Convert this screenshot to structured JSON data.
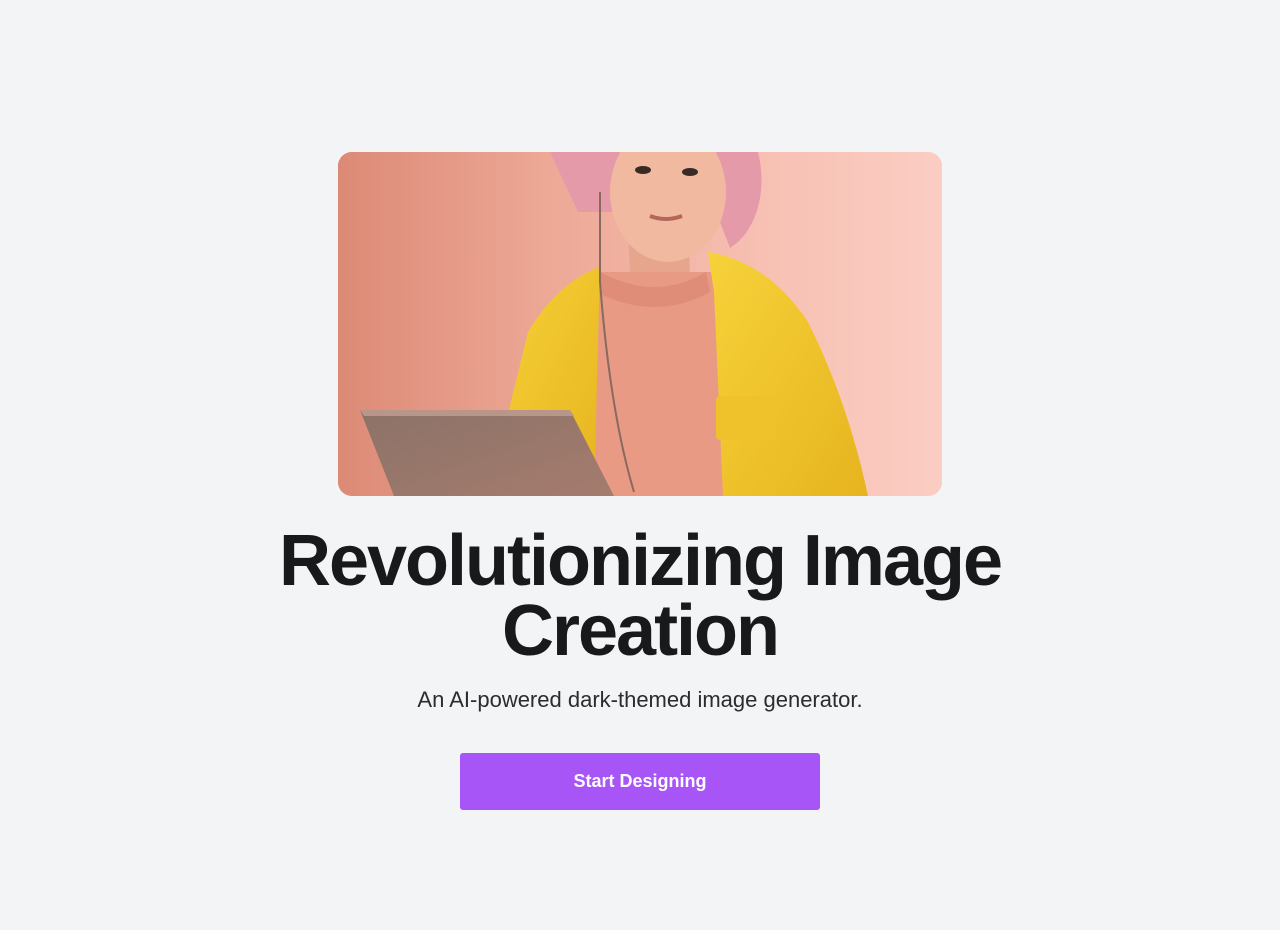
{
  "hero": {
    "image_icon": "portrait-photo",
    "headline": "Revolutionizing Image Creation",
    "subtitle": "An AI-powered dark-themed image generator.",
    "cta_label": "Start Designing"
  },
  "colors": {
    "background": "#f2f4f6",
    "accent": "#a855f7",
    "headline": "#18191b",
    "subtitle": "#2b2c30"
  }
}
